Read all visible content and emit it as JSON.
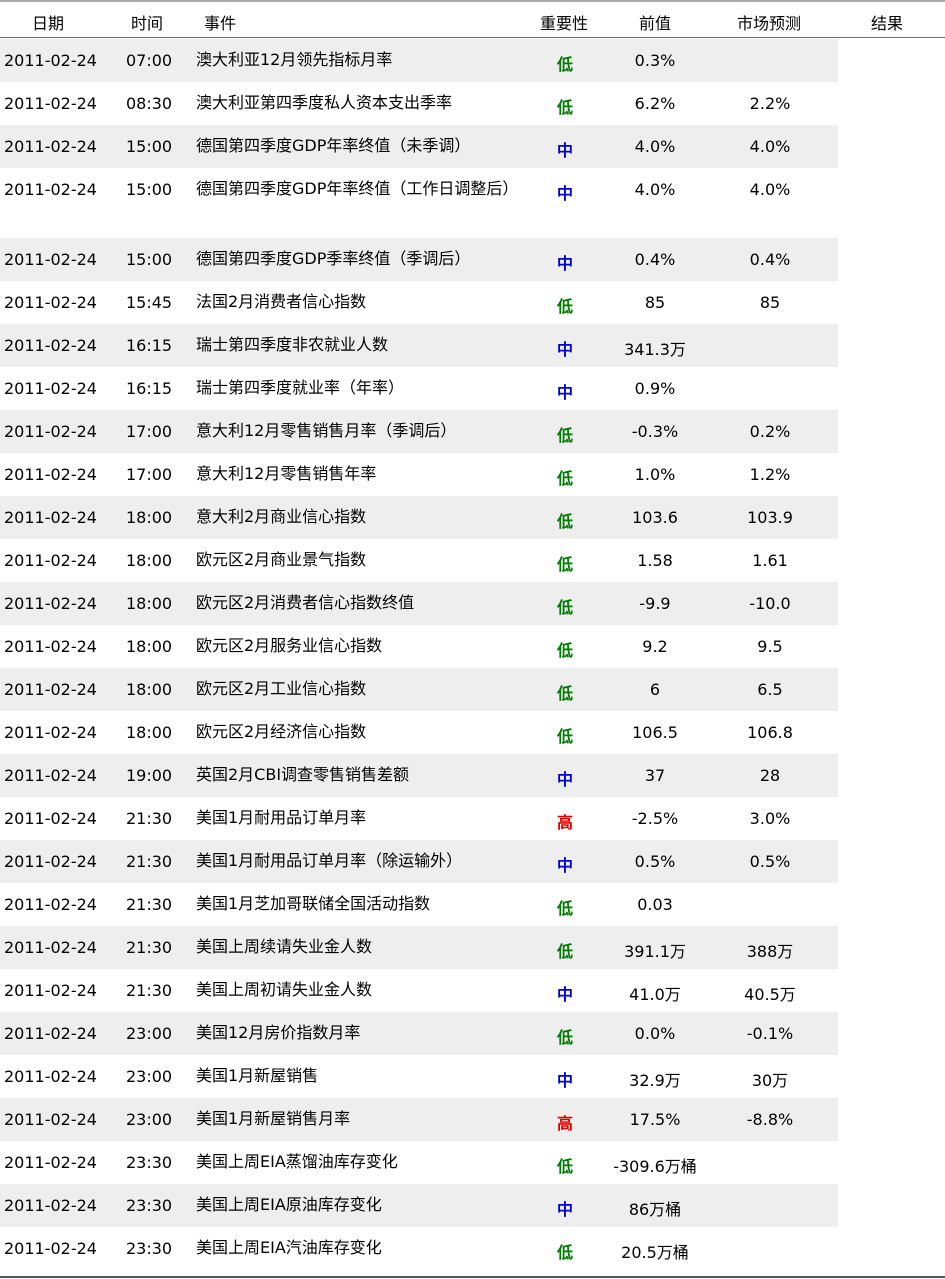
{
  "header": {
    "date": "日期",
    "time": "时间",
    "event": "事件",
    "importance": "重要性",
    "previous": "前值",
    "forecast": "市场预测",
    "result": "结果"
  },
  "colors": {
    "low": "#007a00",
    "mid": "#0000cc",
    "high": "#e00000",
    "row_shade": "#eeeeee"
  },
  "rows": [
    {
      "date": "2011-02-24",
      "time": "07:00",
      "event": "澳大利亚12月领先指标月率",
      "importance": "低",
      "level": "low",
      "previous": "0.3%",
      "forecast": ""
    },
    {
      "date": "2011-02-24",
      "time": "08:30",
      "event": "澳大利亚第四季度私人资本支出季率",
      "importance": "低",
      "level": "low",
      "previous": "6.2%",
      "forecast": "2.2%"
    },
    {
      "date": "2011-02-24",
      "time": "15:00",
      "event": "德国第四季度GDP年率终值（未季调）",
      "importance": "中",
      "level": "mid",
      "previous": "4.0%",
      "forecast": "4.0%"
    },
    {
      "date": "2011-02-24",
      "time": "15:00",
      "event": "德国第四季度GDP年率终值（工作日调整后）",
      "importance": "中",
      "level": "mid",
      "previous": "4.0%",
      "forecast": "4.0%",
      "tall": true
    },
    {
      "date": "2011-02-24",
      "time": "15:00",
      "event": "德国第四季度GDP季率终值（季调后）",
      "importance": "中",
      "level": "mid",
      "previous": "0.4%",
      "forecast": "0.4%"
    },
    {
      "date": "2011-02-24",
      "time": "15:45",
      "event": "法国2月消费者信心指数",
      "importance": "低",
      "level": "low",
      "previous": "85",
      "forecast": "85"
    },
    {
      "date": "2011-02-24",
      "time": "16:15",
      "event": "瑞士第四季度非农就业人数",
      "importance": "中",
      "level": "mid",
      "previous": "341.3万",
      "forecast": ""
    },
    {
      "date": "2011-02-24",
      "time": "16:15",
      "event": "瑞士第四季度就业率（年率）",
      "importance": "中",
      "level": "mid",
      "previous": "0.9%",
      "forecast": ""
    },
    {
      "date": "2011-02-24",
      "time": "17:00",
      "event": "意大利12月零售销售月率（季调后）",
      "importance": "低",
      "level": "low",
      "previous": "-0.3%",
      "forecast": "0.2%"
    },
    {
      "date": "2011-02-24",
      "time": "17:00",
      "event": "意大利12月零售销售年率",
      "importance": "低",
      "level": "low",
      "previous": "1.0%",
      "forecast": "1.2%"
    },
    {
      "date": "2011-02-24",
      "time": "18:00",
      "event": "意大利2月商业信心指数",
      "importance": "低",
      "level": "low",
      "previous": "103.6",
      "forecast": "103.9"
    },
    {
      "date": "2011-02-24",
      "time": "18:00",
      "event": "欧元区2月商业景气指数",
      "importance": "低",
      "level": "low",
      "previous": "1.58",
      "forecast": "1.61"
    },
    {
      "date": "2011-02-24",
      "time": "18:00",
      "event": "欧元区2月消费者信心指数终值",
      "importance": "低",
      "level": "low",
      "previous": "-9.9",
      "forecast": "-10.0"
    },
    {
      "date": "2011-02-24",
      "time": "18:00",
      "event": "欧元区2月服务业信心指数",
      "importance": "低",
      "level": "low",
      "previous": "9.2",
      "forecast": "9.5"
    },
    {
      "date": "2011-02-24",
      "time": "18:00",
      "event": "欧元区2月工业信心指数",
      "importance": "低",
      "level": "low",
      "previous": "6",
      "forecast": "6.5"
    },
    {
      "date": "2011-02-24",
      "time": "18:00",
      "event": "欧元区2月经济信心指数",
      "importance": "低",
      "level": "low",
      "previous": "106.5",
      "forecast": "106.8"
    },
    {
      "date": "2011-02-24",
      "time": "19:00",
      "event": "英国2月CBI调查零售销售差额",
      "importance": "中",
      "level": "mid",
      "previous": "37",
      "forecast": "28"
    },
    {
      "date": "2011-02-24",
      "time": "21:30",
      "event": "美国1月耐用品订单月率",
      "importance": "高",
      "level": "high",
      "previous": "-2.5%",
      "forecast": "3.0%"
    },
    {
      "date": "2011-02-24",
      "time": "21:30",
      "event": "美国1月耐用品订单月率（除运输外）",
      "importance": "中",
      "level": "mid",
      "previous": "0.5%",
      "forecast": "0.5%"
    },
    {
      "date": "2011-02-24",
      "time": "21:30",
      "event": "美国1月芝加哥联储全国活动指数",
      "importance": "低",
      "level": "low",
      "previous": "0.03",
      "forecast": ""
    },
    {
      "date": "2011-02-24",
      "time": "21:30",
      "event": "美国上周续请失业金人数",
      "importance": "低",
      "level": "low",
      "previous": "391.1万",
      "forecast": "388万"
    },
    {
      "date": "2011-02-24",
      "time": "21:30",
      "event": "美国上周初请失业金人数",
      "importance": "中",
      "level": "mid",
      "previous": "41.0万",
      "forecast": "40.5万"
    },
    {
      "date": "2011-02-24",
      "time": "23:00",
      "event": "美国12月房价指数月率",
      "importance": "低",
      "level": "low",
      "previous": "0.0%",
      "forecast": "-0.1%"
    },
    {
      "date": "2011-02-24",
      "time": "23:00",
      "event": "美国1月新屋销售",
      "importance": "中",
      "level": "mid",
      "previous": "32.9万",
      "forecast": "30万"
    },
    {
      "date": "2011-02-24",
      "time": "23:00",
      "event": "美国1月新屋销售月率",
      "importance": "高",
      "level": "high",
      "previous": "17.5%",
      "forecast": "-8.8%"
    },
    {
      "date": "2011-02-24",
      "time": "23:30",
      "event": "美国上周EIA蒸馏油库存变化",
      "importance": "低",
      "level": "low",
      "previous": "-309.6万桶",
      "forecast": ""
    },
    {
      "date": "2011-02-24",
      "time": "23:30",
      "event": "美国上周EIA原油库存变化",
      "importance": "中",
      "level": "mid",
      "previous": "86万桶",
      "forecast": ""
    },
    {
      "date": "2011-02-24",
      "time": "23:30",
      "event": "美国上周EIA汽油库存变化",
      "importance": "低",
      "level": "low",
      "previous": "20.5万桶",
      "forecast": ""
    }
  ]
}
